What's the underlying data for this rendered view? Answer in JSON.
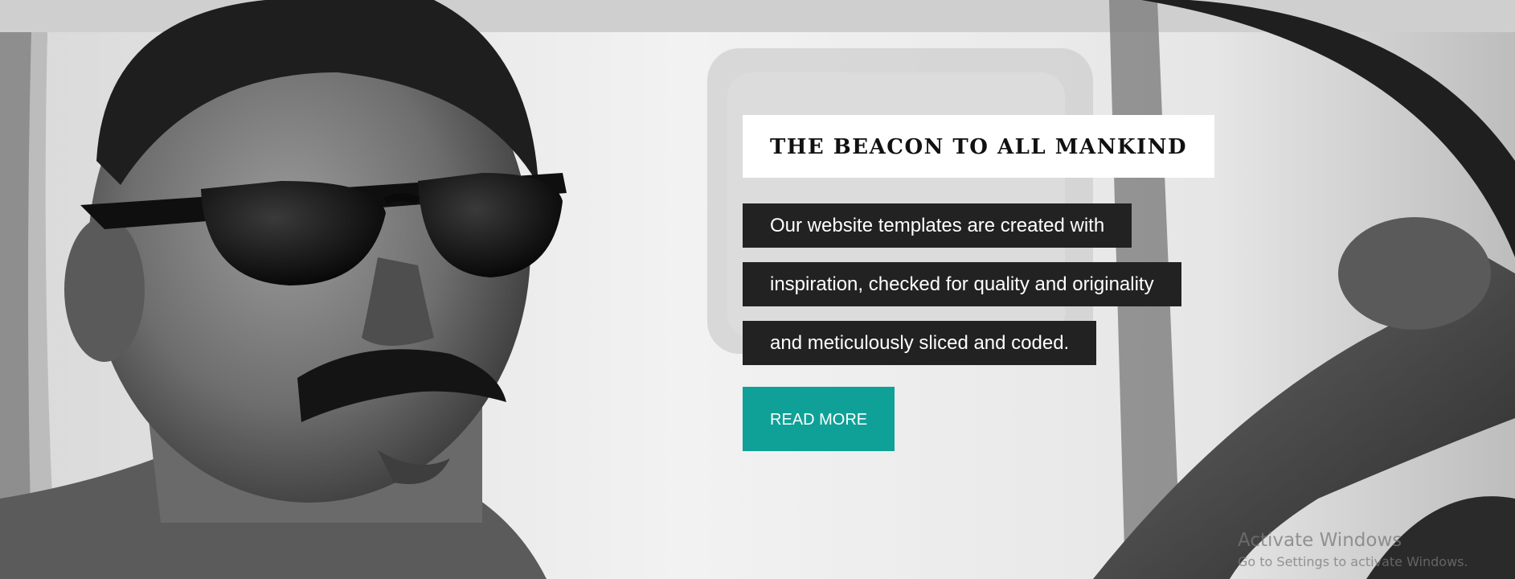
{
  "hero": {
    "image": "black-and-white-man-with-sunglasses-driving-car",
    "title": "THE BEACON TO ALL MANKIND",
    "description_lines": [
      "Our website templates are created with",
      "inspiration, checked for quality and originality",
      "and meticulously sliced and coded."
    ],
    "button_label": "READ MORE"
  },
  "colors": {
    "accent": "#0fa197",
    "text_panel": "#222222",
    "title_panel": "#ffffff"
  },
  "os_watermark": {
    "title": "Activate Windows",
    "subtitle": "Go to Settings to activate Windows."
  }
}
